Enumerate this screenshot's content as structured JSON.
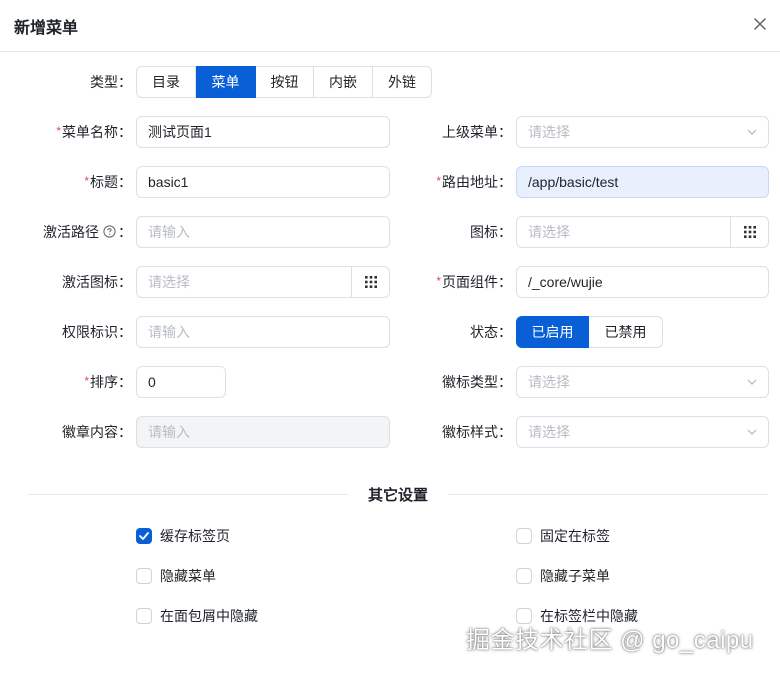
{
  "dialog": {
    "title": "新增菜单"
  },
  "type_field": {
    "label": "类型：",
    "options": [
      "目录",
      "菜单",
      "按钮",
      "内嵌",
      "外链"
    ],
    "selected": "菜单"
  },
  "form": {
    "menu_name": {
      "label": "菜单名称：",
      "value": "测试页面1"
    },
    "parent_menu": {
      "label": "上级菜单：",
      "placeholder": "请选择"
    },
    "title": {
      "label": "标题：",
      "value": "basic1"
    },
    "route_path": {
      "label": "路由地址：",
      "value": "/app/basic/test"
    },
    "active_path": {
      "label": "激活路径",
      "suffix": "：",
      "placeholder": "请输入"
    },
    "icon": {
      "label": "图标：",
      "placeholder": "请选择"
    },
    "active_icon": {
      "label": "激活图标：",
      "placeholder": "请选择"
    },
    "component": {
      "label": "页面组件：",
      "value": "/_core/wujie"
    },
    "permission": {
      "label": "权限标识：",
      "placeholder": "请输入"
    },
    "status": {
      "label": "状态：",
      "options": [
        "已启用",
        "已禁用"
      ],
      "selected": "已启用"
    },
    "order": {
      "label": "排序：",
      "value": "0"
    },
    "badge_type": {
      "label": "徽标类型：",
      "placeholder": "请选择"
    },
    "badge_content": {
      "label": "徽章内容：",
      "placeholder": "请输入"
    },
    "badge_style": {
      "label": "徽标样式：",
      "placeholder": "请选择"
    }
  },
  "other_settings": {
    "title": "其它设置",
    "checkboxes": [
      {
        "label": "缓存标签页",
        "checked": true
      },
      {
        "label": "固定在标签",
        "checked": false
      },
      {
        "label": "隐藏菜单",
        "checked": false
      },
      {
        "label": "隐藏子菜单",
        "checked": false
      },
      {
        "label": "在面包屑中隐藏",
        "checked": false
      },
      {
        "label": "在标签栏中隐藏",
        "checked": false
      }
    ]
  },
  "watermark": "掘金技术社区 @ go_caipu",
  "colors": {
    "primary": "#0960d6",
    "required": "#e34d4d",
    "filled_bg": "#e8f0fe"
  }
}
